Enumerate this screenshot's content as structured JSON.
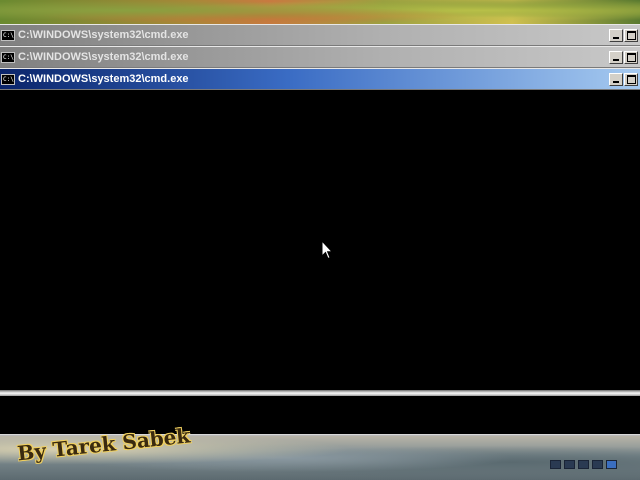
{
  "windows": [
    {
      "title": "C:\\WINDOWS\\system32\\cmd.exe",
      "icon_label": "C:\\",
      "state": "inactive"
    },
    {
      "title": "C:\\WINDOWS\\system32\\cmd.exe",
      "icon_label": "C:\\",
      "state": "inactive"
    },
    {
      "title": "C:\\WINDOWS\\system32\\cmd.exe",
      "icon_label": "C:\\",
      "state": "active"
    }
  ],
  "watermark": {
    "text": "By Tarek Sabek"
  },
  "slideshow": {
    "total": 5,
    "active_index": 4
  },
  "colors": {
    "active_title_start": "#0a246a",
    "active_title_end": "#a6caf0",
    "inactive_title": "#808080",
    "console_background": "#000000"
  },
  "icons": {
    "window_icon": "cmd-icon",
    "minimize": "minimize-icon",
    "maximize": "maximize-icon",
    "cursor": "mouse-pointer-icon"
  }
}
